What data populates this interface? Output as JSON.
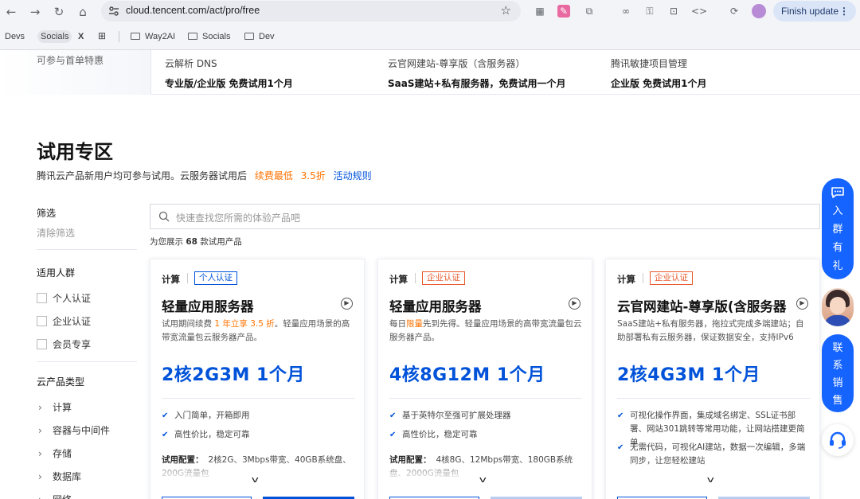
{
  "browser": {
    "url": "cloud.tencent.com/act/pro/free",
    "finish_update_label": "Finish update",
    "bookmarks": [
      "Devs",
      "Socials",
      "X",
      "Way2AI",
      "Socials",
      "Dev"
    ]
  },
  "banner": {
    "left_text": "可参与首单特惠",
    "promos": [
      {
        "title": "云解析 DNS",
        "subtitle": "专业版/企业版 免费试用1个月"
      },
      {
        "title": "云官网建站-尊享版（含服务器）",
        "subtitle": "SaaS建站+私有服务器，免费试用一个月"
      },
      {
        "title": "腾讯敏捷项目管理",
        "subtitle": "企业版 免费试用1个月"
      }
    ]
  },
  "section": {
    "title": "试用专区",
    "desc_prefix": "腾讯云产品新用户均可参与试用。云服务器试用后",
    "desc_highlight_1": "续费最低",
    "desc_highlight_2": "3.5折",
    "desc_link": "活动规则"
  },
  "sidebar": {
    "filter_title": "筛选",
    "clear_filter": "清除筛选",
    "audience_title": "适用人群",
    "audience_options": [
      "个人认证",
      "企业认证",
      "会员专享"
    ],
    "category_title": "云产品类型",
    "categories": [
      "计算",
      "容器与中间件",
      "存储",
      "数据库",
      "网络"
    ]
  },
  "search": {
    "placeholder": "快速查找您所需的体验产品吧",
    "count_prefix": "为您展示",
    "count": "68",
    "count_suffix": "款试用产品"
  },
  "cards": [
    {
      "category": "计算",
      "tag": "个人认证",
      "name": "轻量应用服务器",
      "desc_a": "试用期间续费",
      "desc_b": "1 年立享 3.5 折",
      "desc_c": "。轻量应用场景的高带宽流量包云服务器产品。",
      "spec": "2核2G3M  1个月",
      "features": [
        "入门简单，开箱即用",
        "高性价比，稳定可靠"
      ],
      "config_label": "试用配置：",
      "config": "2核2G、3Mbps带宽、40GB系统盘、200G流量包"
    },
    {
      "category": "计算",
      "tag": "企业认证",
      "name": "轻量应用服务器",
      "desc_a": "每日",
      "desc_b": "限量",
      "desc_c": "先到先得。轻量应用场景的高带宽流量包云服务器产品。",
      "spec": "4核8G12M  1个月",
      "features": [
        "基于英特尔至强可扩展处理器",
        "高性价比，稳定可靠"
      ],
      "config_label": "试用配置：",
      "config": "4核8G、12Mbps带宽、180GB系统盘、2000G流量包"
    },
    {
      "category": "计算",
      "tag": "企业认证",
      "name": "云官网建站-尊享版(含服务器",
      "desc_a": "SaaS建站+私有服务器，拖拉式完成多端建站；自助部署私有云服务器，保证数据安全，支持IPv6",
      "desc_b": "",
      "desc_c": "",
      "spec": "2核4G3M  1个月",
      "features": [
        "可视化操作界面，集成域名绑定、SSL证书部署、网站301跳转等常用功能，让网站搭建更简单",
        "无需代码，可视化AI建站，数据一次编辑，多端同步，让您轻松建站"
      ],
      "config_label": "",
      "config": ""
    }
  ],
  "floating": {
    "group_label": "入群有礼",
    "sales_label": "联系销售"
  },
  "colors": {
    "brand_blue": "#0052d9",
    "accent_orange": "#ff7200",
    "float_blue": "#1664ff"
  }
}
